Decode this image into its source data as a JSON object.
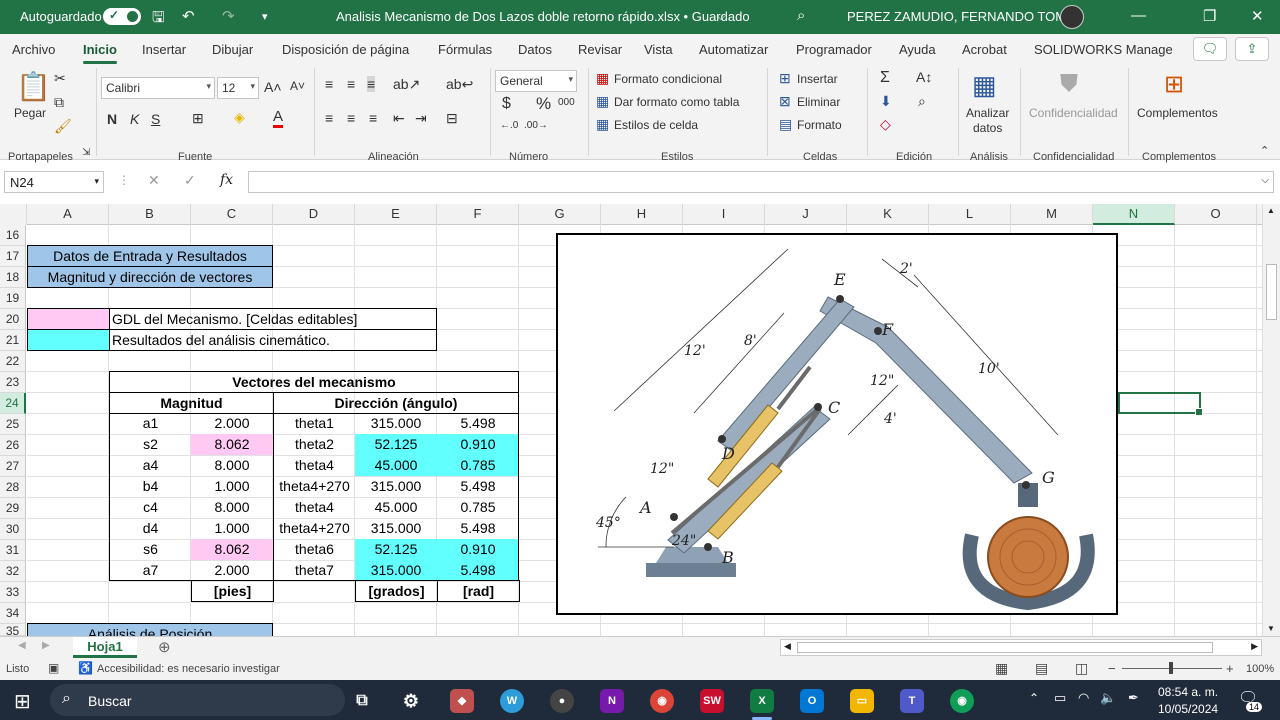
{
  "titlebar": {
    "autosave": "Autoguardado",
    "filename": "Analisis Mecanismo de Dos Lazos doble retorno rápido.xlsx • Guardado",
    "user": "PEREZ ZAMUDIO, FERNANDO TOMAS",
    "accent": "#217346"
  },
  "menu": [
    "Archivo",
    "Inicio",
    "Insertar",
    "Dibujar",
    "Disposición de página",
    "Fórmulas",
    "Datos",
    "Revisar",
    "Vista",
    "Automatizar",
    "Programador",
    "Ayuda",
    "Acrobat",
    "SOLIDWORKS Manage"
  ],
  "ribbon": {
    "pegar": "Pegar",
    "font": "Calibri",
    "size": "12",
    "bold": "N",
    "italic": "K",
    "underline": "S",
    "number_format": "General",
    "cond": "Formato condicional",
    "table": "Dar formato como tabla",
    "styles": "Estilos de celda",
    "insert": "Insertar",
    "delete": "Eliminar",
    "format": "Formato",
    "analizar": "Analizar",
    "datos": "datos",
    "confid": "Confidencialidad",
    "complementos": "Complementos",
    "groups": [
      "Portapapeles",
      "Fuente",
      "Alineación",
      "Número",
      "Estilos",
      "Celdas",
      "Edición",
      "Análisis",
      "Confidencialidad",
      "Complementos"
    ]
  },
  "namebox": "N24",
  "columns": [
    "A",
    "B",
    "C",
    "D",
    "E",
    "F",
    "G",
    "H",
    "I",
    "J",
    "K",
    "L",
    "M",
    "N",
    "O"
  ],
  "rows": [
    "16",
    "17",
    "18",
    "19",
    "20",
    "21",
    "22",
    "23",
    "24",
    "25",
    "26",
    "27",
    "28",
    "29",
    "30",
    "31",
    "32",
    "33",
    "34",
    "35"
  ],
  "cells": {
    "r17": "Datos de Entrada y Resultados",
    "r18": "Magnitud y dirección de vectores",
    "r20": "GDL del Mecanismo. [Celdas editables]",
    "r21": "Resultados del análisis cinemático.",
    "table_title": "Vectores del mecanismo",
    "h_mag": "Magnitud",
    "h_dir": "Dirección (ángulo)",
    "units": [
      "[pies]",
      "[grados]",
      "[rad]"
    ],
    "r35": "Análisis de Posición"
  },
  "table": [
    [
      "a1",
      "2.000",
      "theta1",
      "315.000",
      "5.498"
    ],
    [
      "s2",
      "8.062",
      "theta2",
      "52.125",
      "0.910"
    ],
    [
      "a4",
      "8.000",
      "theta4",
      "45.000",
      "0.785"
    ],
    [
      "b4",
      "1.000",
      "theta4+270",
      "315.000",
      "5.498"
    ],
    [
      "c4",
      "8.000",
      "theta4",
      "45.000",
      "0.785"
    ],
    [
      "d4",
      "1.000",
      "theta4+270",
      "315.000",
      "5.498"
    ],
    [
      "s6",
      "8.062",
      "theta6",
      "52.125",
      "0.910"
    ],
    [
      "a7",
      "2.000",
      "theta7",
      "315.000",
      "5.498"
    ]
  ],
  "figure": {
    "labels": [
      "E",
      "F",
      "C",
      "D",
      "A",
      "B",
      "G",
      "45°",
      "2'",
      "12'",
      "8'",
      "10'",
      "12\"",
      "4'",
      "12\"",
      "24\""
    ]
  },
  "sheet_tab": "Hoja1",
  "status": {
    "ready": "Listo",
    "access": "Accesibilidad: es necesario investigar",
    "zoom": "100%"
  },
  "taskbar": {
    "search": "Buscar",
    "time": "08:54 a. m.",
    "date": "10/05/2024",
    "badge": "14"
  }
}
